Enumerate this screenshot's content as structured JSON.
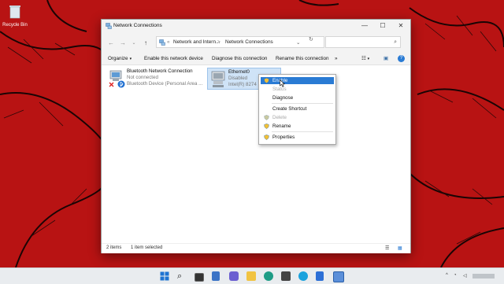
{
  "desktop": {
    "recycle_bin_label": "Recycle Bin"
  },
  "window": {
    "title": "Network Connections",
    "controls": {
      "minimize": "—",
      "maximize": "☐",
      "close": "✕"
    }
  },
  "address": {
    "crumb_ellipsis": "«",
    "crumb1": "Network and Intern...",
    "sep": ">",
    "crumb2": "Network Connections",
    "dropdown": "⌄",
    "refresh": "↻",
    "search_placeholder": ""
  },
  "commands": {
    "organize": "Organize",
    "enable_device": "Enable this network device",
    "diagnose": "Diagnose this connection",
    "rename": "Rename this connection",
    "more": "»"
  },
  "items": [
    {
      "name": "Bluetooth Network Connection",
      "status": "Not connected",
      "device": "Bluetooth Device (Personal Area ..."
    },
    {
      "name": "Ethernet0",
      "status": "Disabled",
      "device": "Intel(R) 8274"
    }
  ],
  "context_menu": {
    "enable": "Enable",
    "status": "Status",
    "diagnose": "Diagnose",
    "create_shortcut": "Create Shortcut",
    "delete": "Delete",
    "rename": "Rename",
    "properties": "Properties"
  },
  "statusbar": {
    "count": "2 items",
    "selected": "1 item selected"
  },
  "colors": {
    "desktop": "#b71212",
    "highlight": "#2a7bd4",
    "selection": "#cfe3f7"
  },
  "icons": [
    "network-icon",
    "search-icon",
    "start-icon",
    "edge-icon",
    "file-explorer-icon",
    "store-icon",
    "skype-icon",
    "wifi-icon",
    "volume-icon"
  ]
}
